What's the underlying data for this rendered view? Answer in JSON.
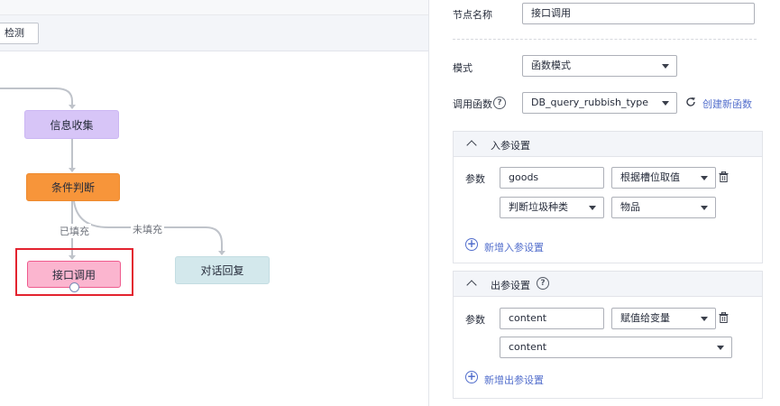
{
  "toolbar": {
    "check_button": "检测"
  },
  "flow": {
    "nodes": {
      "info": "信息收集",
      "condition": "条件判断",
      "api_call": "接口调用",
      "reply": "对话回复"
    },
    "edge_labels": {
      "filled": "已填充",
      "unfilled": "未填充"
    }
  },
  "panel": {
    "node_name_label": "节点名称",
    "node_name_value": "接口调用",
    "mode_label": "模式",
    "mode_value": "函数模式",
    "function_label": "调用函数",
    "function_value": "DB_query_rubbish_type",
    "create_function_link": "创建新函数",
    "input_section": {
      "title": "入参设置",
      "param_label": "参数",
      "name_value": "goods",
      "source_value": "根据槽位取值",
      "slot_value": "判断垃圾种类",
      "item_value": "物品",
      "add_label": "新增入参设置"
    },
    "output_section": {
      "title": "出参设置",
      "param_label": "参数",
      "name_value": "content",
      "assign_value": "赋值给变量",
      "var_value": "content",
      "add_label": "新增出参设置"
    }
  },
  "colors": {
    "node_info": "#d7c5f7",
    "node_condition": "#f7953a",
    "node_call": "#fbb5cf",
    "node_reply": "#d3e8ec",
    "selection": "#e3232f",
    "link": "#526ecc"
  }
}
